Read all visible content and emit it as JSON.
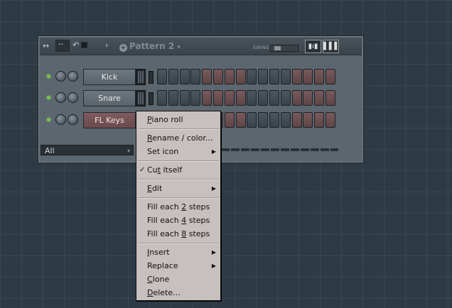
{
  "rack": {
    "pattern_name": "Pattern 2",
    "swing_label": "SWING",
    "swing_value": 0.15,
    "filter_value": "All",
    "channels": [
      {
        "name": "Kick",
        "active": false
      },
      {
        "name": "Snare",
        "active": false
      },
      {
        "name": "FL Keys",
        "active": true
      }
    ]
  },
  "context_menu": {
    "items": [
      {
        "pre": "",
        "u": "P",
        "post": "iano roll"
      },
      {
        "pre": "",
        "u": "R",
        "post": "ename / color..."
      },
      {
        "pre": "Set icon",
        "u": "",
        "post": ""
      },
      {
        "pre": "Cu",
        "u": "t",
        "post": " itself"
      },
      {
        "pre": "",
        "u": "E",
        "post": "dit"
      },
      {
        "pre": "Fill each ",
        "u": "2",
        "post": " steps"
      },
      {
        "pre": "Fill each ",
        "u": "4",
        "post": " steps"
      },
      {
        "pre": "Fill each ",
        "u": "8",
        "post": " steps"
      },
      {
        "pre": "",
        "u": "I",
        "post": "nsert"
      },
      {
        "pre": "Replace",
        "u": "",
        "post": ""
      },
      {
        "pre": "",
        "u": "C",
        "post": "lone"
      },
      {
        "pre": "",
        "u": "D",
        "post": "elete..."
      }
    ],
    "checked_item": "Cut itself"
  },
  "icons": {
    "arrows": "↔",
    "undo": "↶",
    "forward": "›",
    "submenu": "▶",
    "check": "✓",
    "dropdown": "▾"
  }
}
